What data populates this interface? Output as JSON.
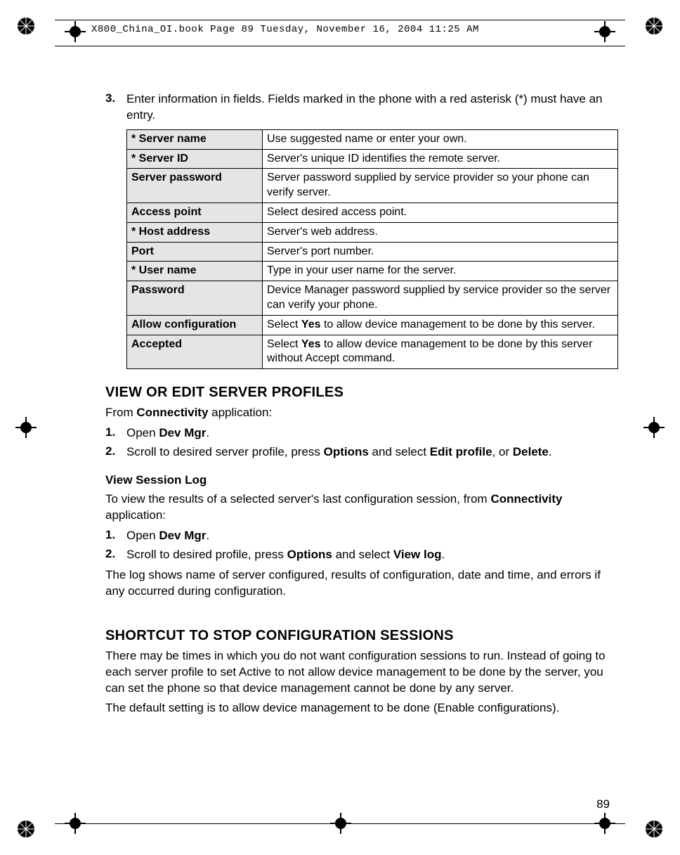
{
  "header": {
    "filename_line": "X800_China_OI.book  Page 89  Tuesday, November 16, 2004  11:25 AM"
  },
  "intro": {
    "num": "3.",
    "text": "Enter information in fields. Fields marked in the phone with a red asterisk (*) must have an entry."
  },
  "table_rows": [
    {
      "field": "* Server name",
      "desc": "Use suggested name or enter your own."
    },
    {
      "field": "* Server ID",
      "desc": "Server's unique ID identifies the remote server."
    },
    {
      "field": "Server password",
      "desc": "Server password supplied by service provider so your phone can verify server."
    },
    {
      "field": "Access point",
      "desc": "Select desired access point."
    },
    {
      "field": "* Host address",
      "desc": "Server's web address."
    },
    {
      "field": "Port",
      "desc": "Server's port number."
    },
    {
      "field": "* User name",
      "desc": "Type in your user name for the server."
    },
    {
      "field": "Password",
      "desc": "Device Manager password supplied by service provider so the server can verify your phone."
    },
    {
      "field": "Allow configuration",
      "desc_html": "Select <b>Yes</b> to allow device management to be done by this server."
    },
    {
      "field": "Accepted",
      "desc_html": "Select <b>Yes</b> to allow device management to be done by this server without Accept command."
    }
  ],
  "view_edit": {
    "heading": "VIEW OR EDIT SERVER PROFILES",
    "from_html": "From <b>Connectivity</b> application:",
    "steps": [
      {
        "num": "1.",
        "html": "Open <b>Dev Mgr</b>."
      },
      {
        "num": "2.",
        "html": "Scroll to desired server profile, press <b>Options</b> and select <b>Edit profile</b>, or <b>Delete</b>."
      }
    ]
  },
  "session_log": {
    "heading": "View Session Log",
    "intro_html": "To view the results of a selected server's last configuration session, from <b>Connectivity</b> application:",
    "steps": [
      {
        "num": "1.",
        "html": "Open <b>Dev Mgr</b>."
      },
      {
        "num": "2.",
        "html": "Scroll to desired profile, press <b>Options</b> and select <b>View log</b>."
      }
    ],
    "outro": "The log shows name of server configured, results of configuration, date and time, and errors if any occurred during configuration."
  },
  "shortcut": {
    "heading": "SHORTCUT TO STOP CONFIGURATION SESSIONS",
    "p1": "There may be times in which you do not want configuration sessions to run. Instead of going to each server profile to set Active to not allow device management to be done by the server, you can set the phone so that device management cannot be done by any server.",
    "p2": "The default setting is to allow device management to be done (Enable configurations)."
  },
  "page_number": "89"
}
